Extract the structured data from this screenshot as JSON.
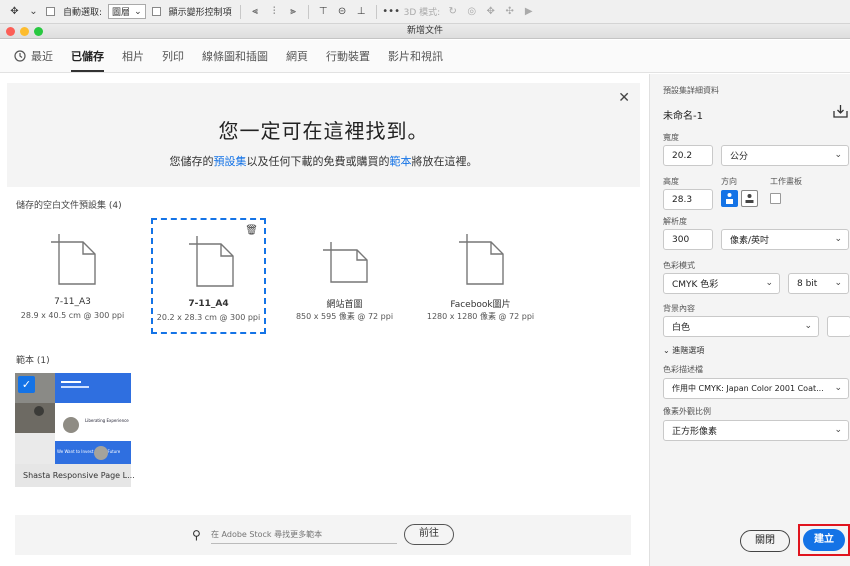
{
  "optbar": {
    "auto_select_label": "自動選取:",
    "auto_select_value": "圖層",
    "transform_controls_label": "顯示變形控制項",
    "mode_3d_label": "3D 模式:"
  },
  "window": {
    "title": "新增文件"
  },
  "tabs": [
    {
      "label": "最近"
    },
    {
      "label": "已儲存"
    },
    {
      "label": "相片"
    },
    {
      "label": "列印"
    },
    {
      "label": "線條圖和插圖"
    },
    {
      "label": "網頁"
    },
    {
      "label": "行動裝置"
    },
    {
      "label": "影片和視訊"
    }
  ],
  "banner": {
    "heading": "您一定可在這裡找到。",
    "text_before": "您儲存的",
    "link1": "預設集",
    "text_middle": "以及任何下載的免費或購買的",
    "link2": "範本",
    "text_after": "將放在這裡。"
  },
  "saved_presets": {
    "title": "儲存的空白文件預設集",
    "count": "(4)",
    "items": [
      {
        "name": "7-11_A3",
        "dims": "28.9 x 40.5 cm @ 300 ppi"
      },
      {
        "name": "7-11_A4",
        "dims": "20.2 x 28.3 cm @ 300 ppi"
      },
      {
        "name": "網站首圖",
        "dims": "850 x 595 像素 @ 72 ppi"
      },
      {
        "name": "Facebook圖片",
        "dims": "1280 x 1280 像素 @ 72 ppi"
      }
    ]
  },
  "templates": {
    "title": "範本",
    "count": "(1)",
    "items": [
      {
        "name": "Shasta Responsive Page L...",
        "preview_text_1": "Liberating Experience",
        "preview_text_2": "We Want to Invest in the Future"
      }
    ]
  },
  "search": {
    "placeholder": "在 Adobe Stock 尋找更多範本",
    "go_label": "前往"
  },
  "details": {
    "header": "預設集詳細資料",
    "doc_name": "未命名-1",
    "width_label": "寬度",
    "width_value": "20.2",
    "width_unit": "公分",
    "height_label": "高度",
    "height_value": "28.3",
    "orientation_label": "方向",
    "artboard_label": "工作畫板",
    "resolution_label": "解析度",
    "resolution_value": "300",
    "resolution_unit": "像素/英吋",
    "color_mode_label": "色彩模式",
    "color_mode_value": "CMYK 色彩",
    "bit_depth_value": "8 bit",
    "background_label": "背景內容",
    "background_value": "白色",
    "advanced_label": "進階選項",
    "color_profile_label": "色彩描述檔",
    "color_profile_value": "作用中 CMYK: Japan Color 2001 Coat...",
    "pixel_aspect_label": "像素外觀比例",
    "pixel_aspect_value": "正方形像素"
  },
  "buttons": {
    "close": "關閉",
    "create": "建立"
  },
  "colors": {
    "accent": "#1473e6",
    "highlight": "#e0141e"
  }
}
